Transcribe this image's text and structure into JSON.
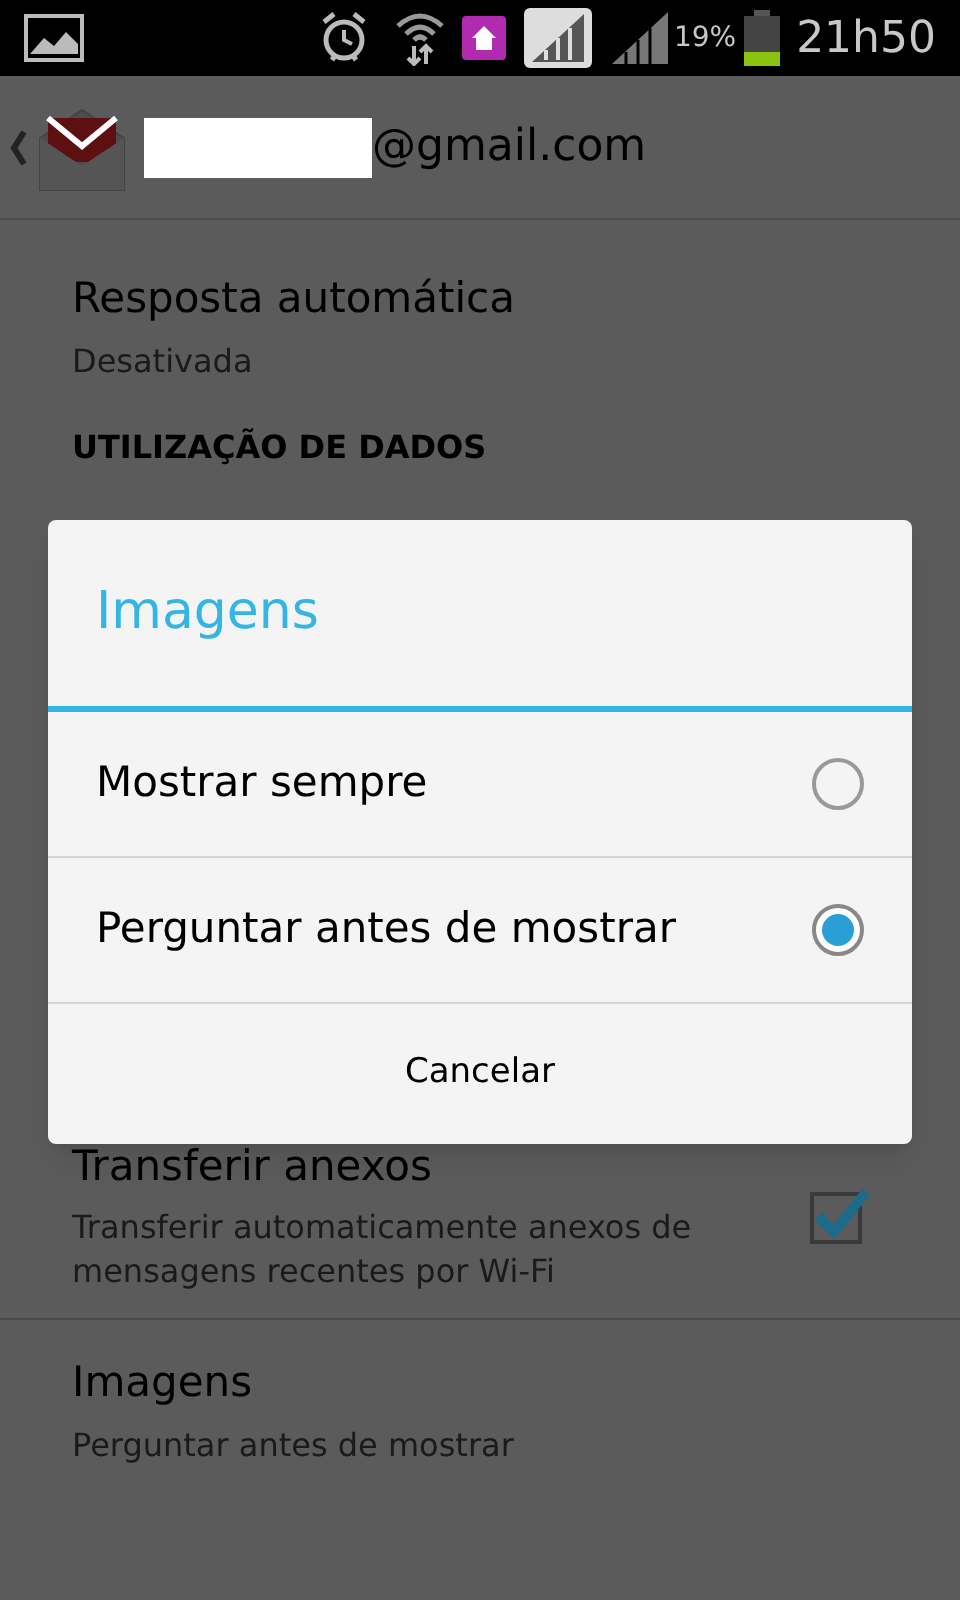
{
  "status_bar": {
    "battery": "19%",
    "time": "21h50"
  },
  "header": {
    "account": "@gmail.com"
  },
  "settings": [
    {
      "kind": "text",
      "title": "Resposta automática",
      "summary": "Desativada"
    },
    {
      "kind": "section",
      "title": "UTILIZAÇÃO DE DADOS"
    },
    {
      "kind": "checkbox",
      "title": "Transferir anexos",
      "summary": "Transferir automaticamente anexos de mensagens recentes por Wi-Fi",
      "checked": true
    },
    {
      "kind": "text",
      "title": "Imagens",
      "summary": "Perguntar antes de mostrar"
    }
  ],
  "dialog": {
    "title": "Imagens",
    "options": [
      {
        "label": "Mostrar sempre",
        "selected": false
      },
      {
        "label": "Perguntar antes de mostrar",
        "selected": true
      }
    ],
    "cancel": "Cancelar"
  }
}
